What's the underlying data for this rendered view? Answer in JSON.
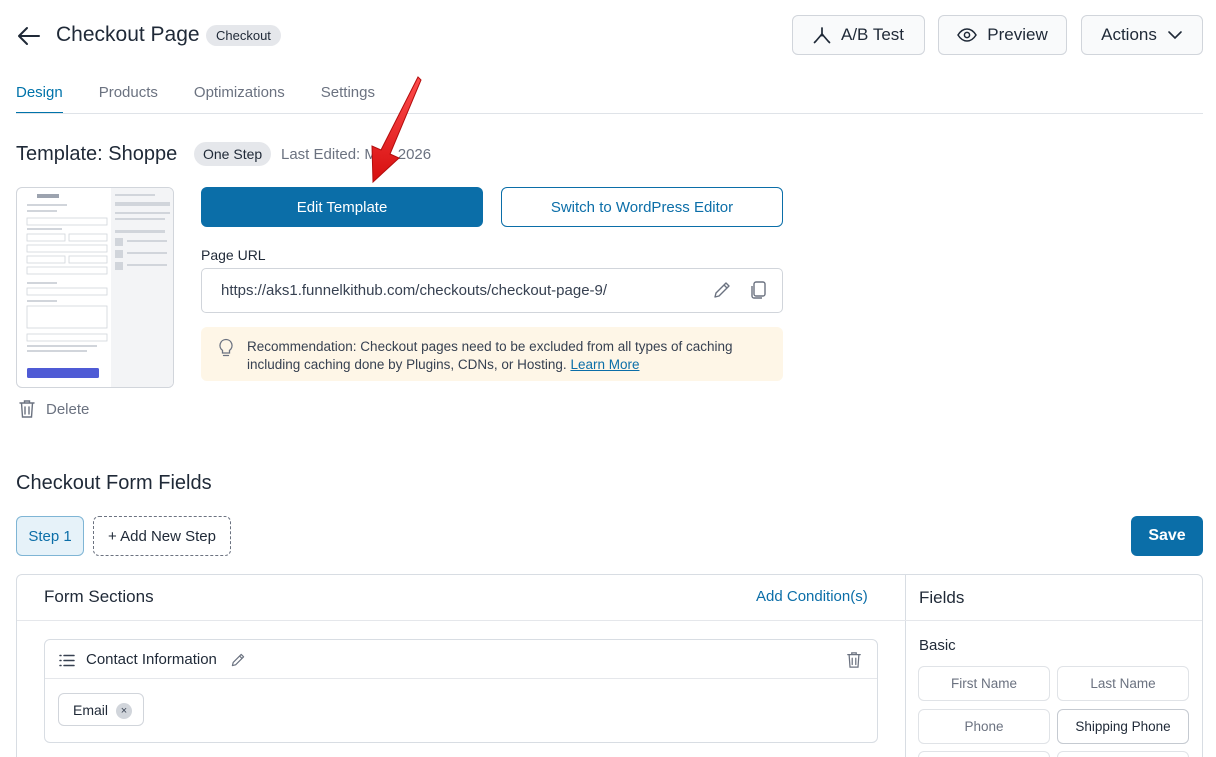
{
  "header": {
    "title": "Checkout Page",
    "badge": "Checkout",
    "ab_test_label": "A/B Test",
    "preview_label": "Preview",
    "actions_label": "Actions"
  },
  "tabs": [
    {
      "label": "Design",
      "active": true
    },
    {
      "label": "Products",
      "active": false
    },
    {
      "label": "Optimizations",
      "active": false
    },
    {
      "label": "Settings",
      "active": false
    }
  ],
  "template": {
    "title": "Template: Shoppe",
    "badge": "One Step",
    "last_edited": "Last Edited: M  8, 2026",
    "delete_label": "Delete",
    "edit_label": "Edit Template",
    "switch_label": "Switch to WordPress Editor",
    "url_label": "Page URL",
    "url_value": "https://aks1.funnelkithub.com/checkouts/checkout-page-9/",
    "recommendation_line1": "Recommendation: Checkout pages need to be excluded from all types of caching",
    "recommendation_line2": "including caching done by Plugins, CDNs, or Hosting.",
    "learn_more": "Learn More"
  },
  "form_fields": {
    "title": "Checkout Form Fields",
    "step_label": "Step 1",
    "add_step_label": "+ Add New Step",
    "save_label": "Save",
    "sections_title": "Form Sections",
    "add_condition_label": "Add Condition(s)",
    "fields_title": "Fields",
    "section_name": "Contact Information",
    "section_chip": "Email",
    "basic_label": "Basic",
    "basic_fields": [
      "First Name",
      "Last Name",
      "Phone",
      "Shipping Phone"
    ]
  },
  "colors": {
    "primary": "#0b6ea8",
    "annotation_arrow": "#e11d1d",
    "recommendation_bg": "#fef6e7"
  }
}
